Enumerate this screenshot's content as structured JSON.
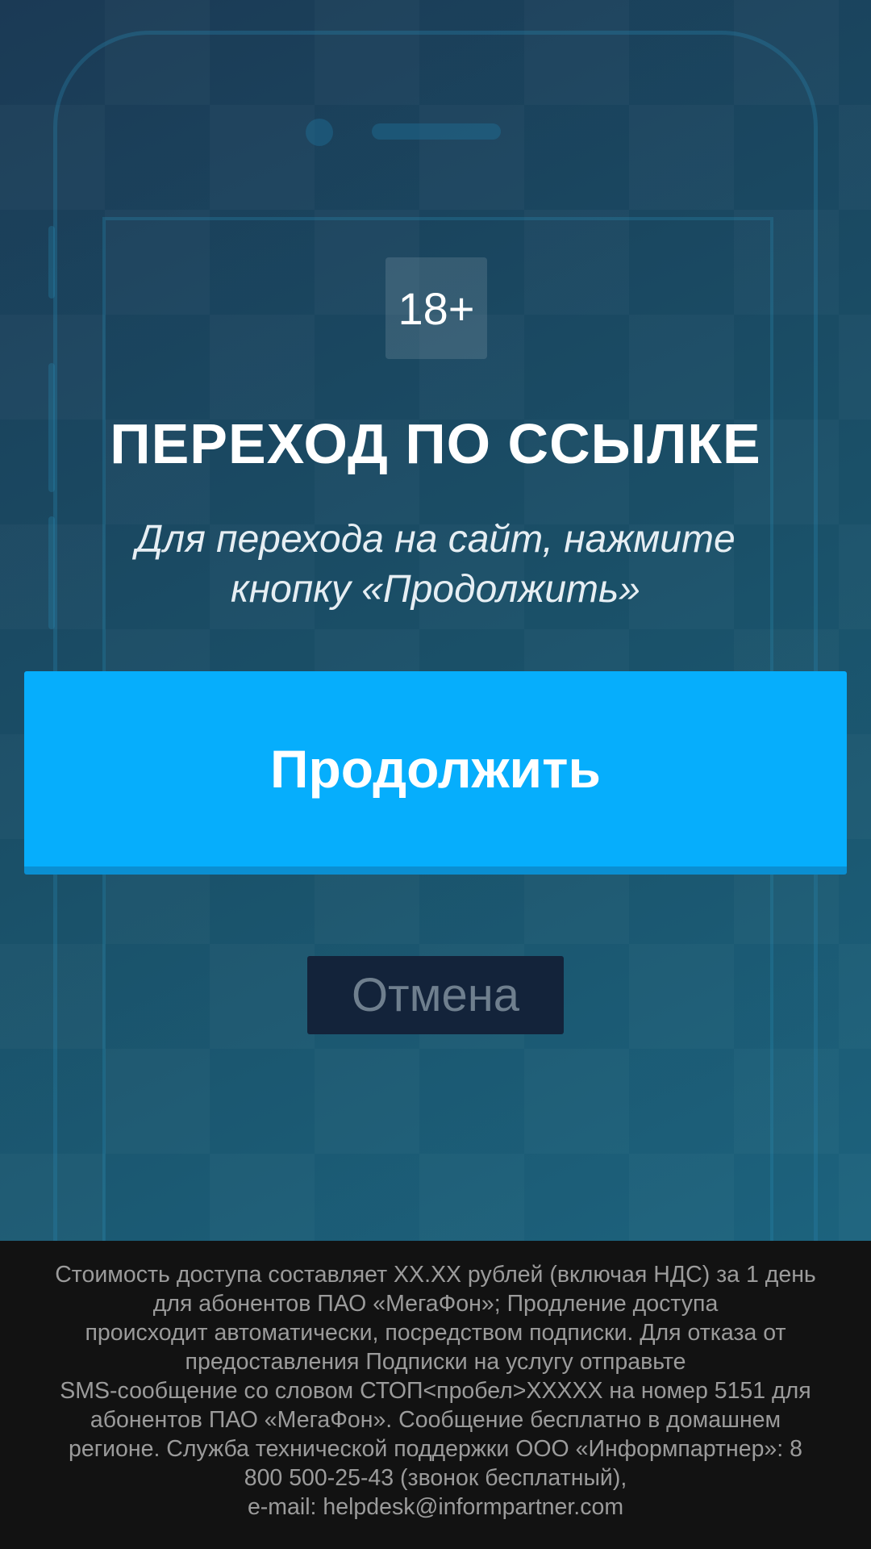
{
  "age_badge": "18+",
  "title": "ПЕРЕХОД ПО ССЫЛКЕ",
  "subtitle": "Для перехода на сайт, нажмите кнопку «Продолжить»",
  "buttons": {
    "continue_label": "Продолжить",
    "cancel_label": "Отмена"
  },
  "footer": {
    "text": "Стоимость доступа составляет XX.XX рублей (включая НДС) за 1 день\nдля абонентов ПАО «МегаФон»; Продление доступа\nпроисходит автоматически, посредством подписки. Для отказа от\nпредоставления Подписки на услугу отправьте\nSMS-сообщение со словом СТОП<пробел>XXXXX на номер 5151 для\nабонентов ПАО «МегаФон». Сообщение бесплатно в домашнем\nрегионе. Служба технической поддержки ООО «Информпартнер»: 8\n800 500-25-43 (звонок бесплатный),\ne-mail: helpdesk@informpartner.com"
  },
  "colors": {
    "continue_button": "#06aefc",
    "cancel_button": "#13233a",
    "footer_background": "#121212"
  }
}
